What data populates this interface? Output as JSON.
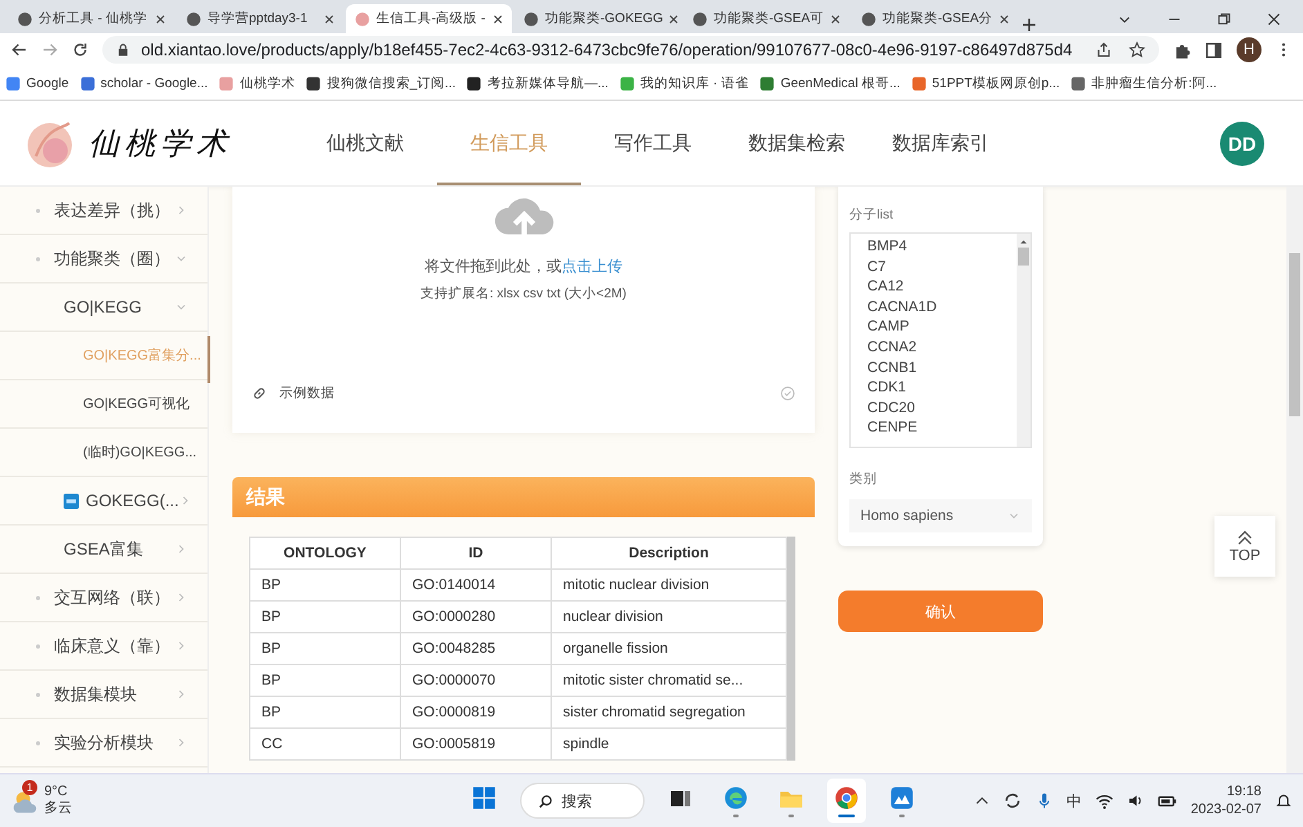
{
  "browser": {
    "tabs": [
      {
        "title": "分析工具 - 仙桃学",
        "selected": false
      },
      {
        "title": "导学营pptday3-1",
        "selected": false
      },
      {
        "title": "生信工具-高级版 -",
        "selected": true
      },
      {
        "title": "功能聚类-GOKEGG",
        "selected": false
      },
      {
        "title": "功能聚类-GSEA可",
        "selected": false
      },
      {
        "title": "功能聚类-GSEA分",
        "selected": false
      }
    ],
    "url": "old.xiantao.love/products/apply/b18ef455-7ec2-4c63-9312-6473cbc9fe76/operation/99107677-08c0-4e96-9197-c86497d875d4",
    "profile_initial": "H",
    "bookmarks": [
      {
        "label": "Google",
        "color": "#4285f4"
      },
      {
        "label": "scholar - Google...",
        "color": "#3b6fd8"
      },
      {
        "label": "仙桃学术",
        "color": "#e8a0a0"
      },
      {
        "label": "搜狗微信搜索_订阅...",
        "color": "#333333"
      },
      {
        "label": "考拉新媒体导航—...",
        "color": "#222222"
      },
      {
        "label": "我的知识库 · 语雀",
        "color": "#3bb346"
      },
      {
        "label": "GeenMedical 根哥...",
        "color": "#2e7d32"
      },
      {
        "label": "51PPT模板网原创p...",
        "color": "#e8662a"
      },
      {
        "label": "非肿瘤生信分析:阿...",
        "color": "#666666"
      }
    ]
  },
  "site": {
    "brand": "仙桃学术",
    "nav": [
      {
        "label": "仙桃文献",
        "selected": false
      },
      {
        "label": "生信工具",
        "selected": true
      },
      {
        "label": "写作工具",
        "selected": false
      },
      {
        "label": "数据集检索",
        "selected": false
      },
      {
        "label": "数据库索引",
        "selected": false
      }
    ],
    "user_initials": "DD"
  },
  "sidebar": {
    "items": [
      {
        "label": "表达差异（挑）",
        "selected": false,
        "expanded": false
      },
      {
        "label": "功能聚类（圈）",
        "selected": false,
        "expanded": true,
        "children": [
          {
            "label": "GO|KEGG",
            "kind": "plain",
            "selected": false,
            "expanded": true,
            "children": [
              {
                "label": "GO|KEGG富集分...",
                "selected": true
              },
              {
                "label": "GO|KEGG可视化",
                "selected": false
              },
              {
                "label": "(临时)GO|KEGG...",
                "selected": false
              }
            ]
          },
          {
            "label": "GOKEGG(...",
            "kind": "new",
            "selected": false,
            "expanded": false
          },
          {
            "label": "GSEA富集",
            "kind": "plain",
            "selected": false,
            "expanded": false
          }
        ]
      },
      {
        "label": "交互网络（联）",
        "selected": false,
        "expanded": false
      },
      {
        "label": "临床意义（靠）",
        "selected": false,
        "expanded": false
      },
      {
        "label": "数据集模块",
        "selected": false,
        "expanded": false
      },
      {
        "label": "实验分析模块",
        "selected": false,
        "expanded": false
      }
    ]
  },
  "upload": {
    "prompt": "将文件拖到此处，或",
    "link": "点击上传",
    "hint": "支持扩展名: xlsx csv txt (大小<2M)",
    "example_link": "示例数据"
  },
  "results": {
    "title": "结果",
    "columns": [
      "ONTOLOGY",
      "ID",
      "Description"
    ],
    "rows": [
      [
        "BP",
        "GO:0140014",
        "mitotic nuclear division"
      ],
      [
        "BP",
        "GO:0000280",
        "nuclear division"
      ],
      [
        "BP",
        "GO:0048285",
        "organelle fission"
      ],
      [
        "BP",
        "GO:0000070",
        "mitotic sister chromatid se..."
      ],
      [
        "BP",
        "GO:0000819",
        "sister chromatid segregation"
      ],
      [
        "CC",
        "GO:0005819",
        "spindle"
      ]
    ]
  },
  "form": {
    "molecule_label": "分子list",
    "molecules": [
      "BMP4",
      "C7",
      "CA12",
      "CACNA1D",
      "CAMP",
      "CCNA2",
      "CCNB1",
      "CDK1",
      "CDC20",
      "CENPE"
    ],
    "category_label": "类别",
    "category_value": "Homo sapiens",
    "confirm": "确认"
  },
  "top_button": "TOP",
  "taskbar": {
    "weather_badge": "1",
    "temperature": "9°C",
    "weather": "多云",
    "search": "搜索",
    "apps": [
      {
        "kind": "start",
        "open": false,
        "selected": false
      },
      {
        "kind": "taskview",
        "open": false,
        "selected": false
      },
      {
        "kind": "edge",
        "open": true,
        "selected": false
      },
      {
        "kind": "files",
        "open": true,
        "selected": false
      },
      {
        "kind": "chrome",
        "open": true,
        "selected": true
      },
      {
        "kind": "app",
        "open": true,
        "selected": false
      }
    ],
    "ime": "中",
    "time": "19:18",
    "date": "2023-02-07"
  }
}
